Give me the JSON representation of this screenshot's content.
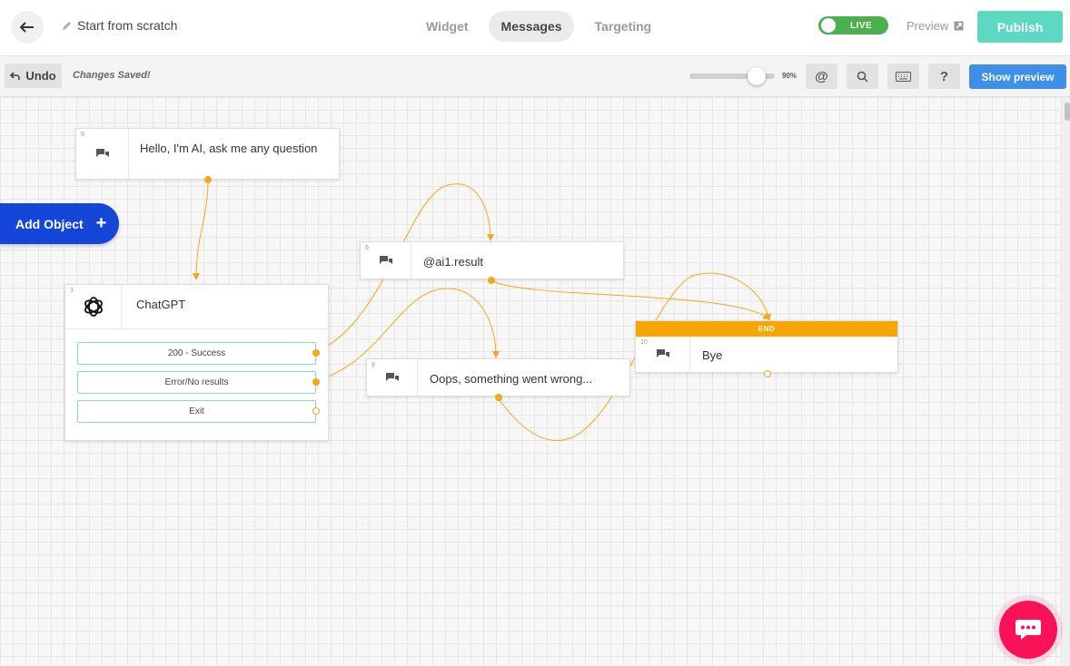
{
  "header": {
    "back_icon": "arrow-left-icon",
    "title_icon": "pencil-icon",
    "title": "Start from scratch",
    "tabs": [
      {
        "label": "Widget",
        "active": false
      },
      {
        "label": "Messages",
        "active": true
      },
      {
        "label": "Targeting",
        "active": false
      }
    ],
    "live_label": "LIVE",
    "live_color": "#4caf50",
    "preview_label": "Preview",
    "preview_icon": "external-link-icon",
    "publish_label": "Publish",
    "publish_color": "#5dd8c2"
  },
  "toolbar": {
    "undo_label": "Undo",
    "undo_icon": "undo-arrow-icon",
    "saved_text": "Changes Saved!",
    "zoom_label": "90%",
    "zoom_level": 0.79,
    "mention_symbol": "@",
    "search_icon": "search-icon",
    "keyboard_icon": "keyboard-icon",
    "help_symbol": "?",
    "show_preview_label": "Show preview",
    "show_preview_color": "#3d8fe8"
  },
  "canvas": {
    "add_object_label": "Add Object",
    "add_object_plus": "+",
    "add_object_color": "#1447d8",
    "connector_color": "#f4a81b",
    "nodes": {
      "hello": {
        "id": "9",
        "icon": "chat-bubbles-icon",
        "text": "Hello, I'm AI, ask me any question"
      },
      "ai_result": {
        "id": "6",
        "icon": "chat-bubbles-icon",
        "text": "@ai1.result"
      },
      "chatgpt": {
        "id": "3",
        "icon": "openai-logo-icon",
        "title": "ChatGPT",
        "options": [
          "200 - Success",
          "Error/No results",
          "Exit"
        ]
      },
      "oops": {
        "id": "8",
        "icon": "chat-bubbles-icon",
        "text": "Oops, something went wrong..."
      },
      "bye": {
        "id": "10",
        "icon": "chat-bubbles-icon",
        "text": "Bye",
        "banner": "END",
        "banner_color": "#f7a500"
      }
    }
  },
  "chat_widget": {
    "icon": "chat-bubble-icon",
    "color": "#fa1259"
  }
}
